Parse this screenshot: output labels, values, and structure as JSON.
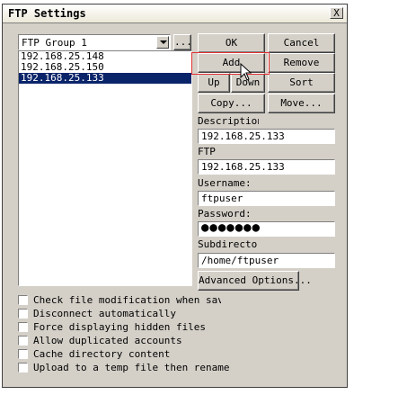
{
  "window": {
    "title": "FTP Settings",
    "close_label": "X"
  },
  "group_combo": {
    "value": "FTP Group 1",
    "browse_label": "..."
  },
  "buttons": {
    "ok": "OK",
    "cancel": "Cancel",
    "add": "Add",
    "remove": "Remove",
    "up": "Up",
    "down": "Down",
    "sort": "Sort",
    "copy": "Copy...",
    "move": "Move...",
    "advanced": "Advanced Options..."
  },
  "server_list": [
    {
      "label": "192.168.25.148",
      "selected": false
    },
    {
      "label": "192.168.25.150",
      "selected": false
    },
    {
      "label": "192.168.25.133",
      "selected": true
    }
  ],
  "fields": {
    "description": {
      "label": "Description",
      "value": "192.168.25.133"
    },
    "ftp": {
      "label": "FTP",
      "value": "192.168.25.133"
    },
    "username": {
      "label": "Username:",
      "value": "ftpuser"
    },
    "password": {
      "label": "Password:",
      "value": "●●●●●●●"
    },
    "subdirectory": {
      "label": "Subdirector",
      "value": "/home/ftpuser"
    }
  },
  "options": [
    {
      "label": "Check file modification when saving",
      "checked": false
    },
    {
      "label": "Disconnect automatically",
      "checked": false
    },
    {
      "label": "Force displaying hidden files",
      "checked": false
    },
    {
      "label": "Allow duplicated accounts",
      "checked": false
    },
    {
      "label": "Cache directory content",
      "checked": false
    },
    {
      "label": "Upload to a temp file then rename",
      "checked": false
    }
  ],
  "colors": {
    "selection": "#0a246a",
    "highlight_box": "#e03030",
    "dialog_bg": "#d4d0c8"
  }
}
